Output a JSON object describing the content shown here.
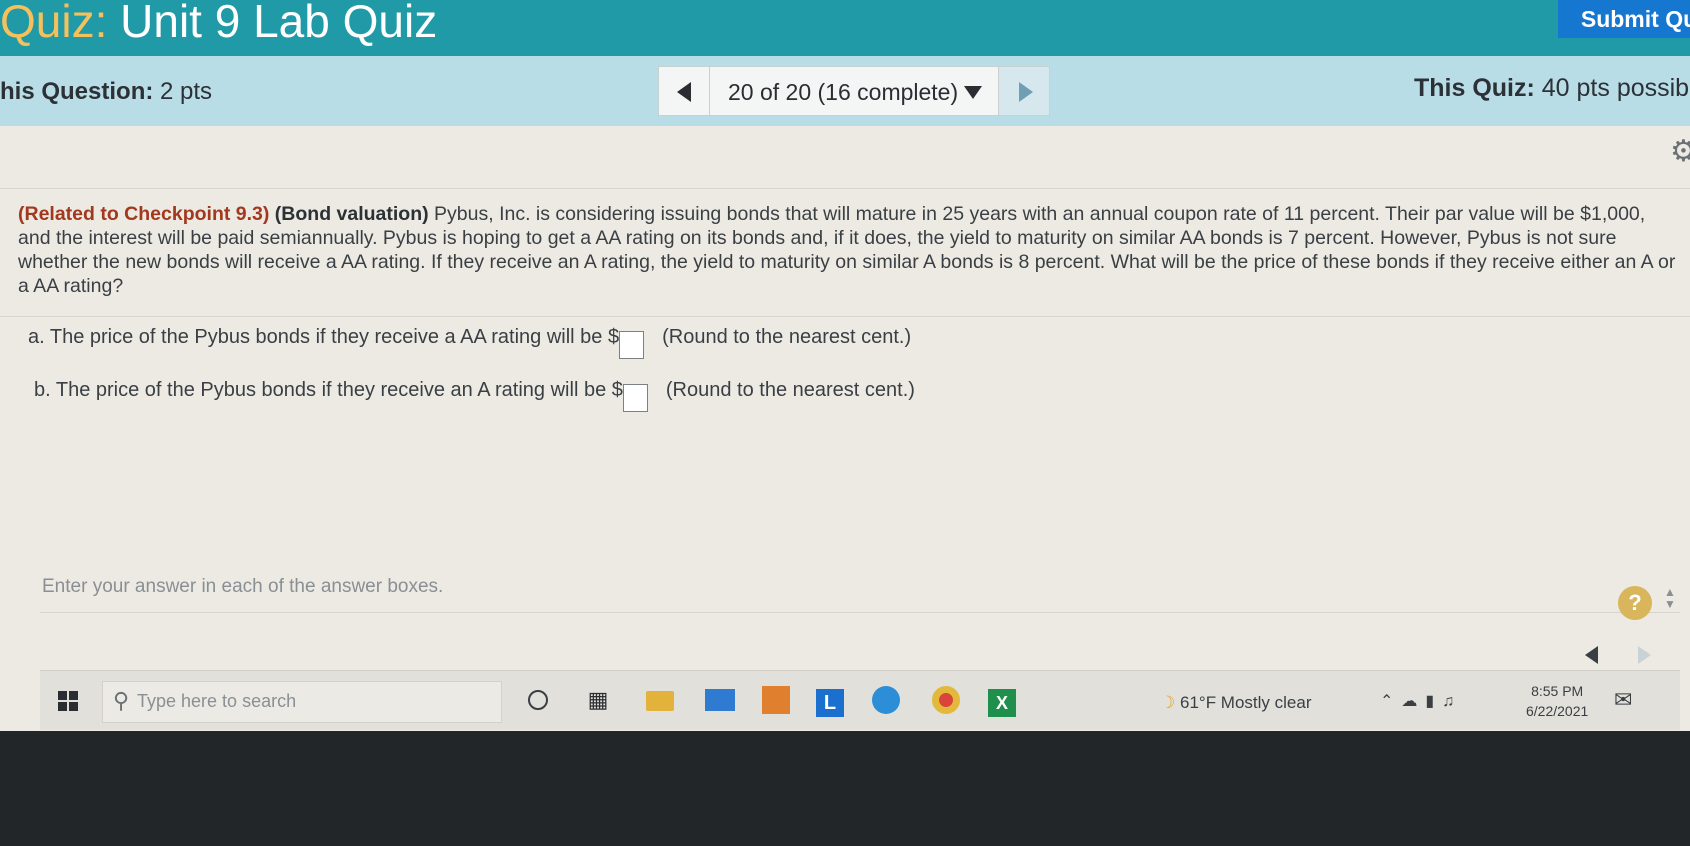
{
  "header": {
    "title_prefix": "Quiz:",
    "title_rest": " Unit 9 Lab Quiz",
    "submit_label": "Submit Qu"
  },
  "infobar": {
    "question_label": "his Question:",
    "question_pts": " 2 pts",
    "progress": "20 of 20 (16 complete)",
    "quiz_label": "This Quiz:",
    "quiz_pts": " 40 pts possib"
  },
  "question": {
    "ref": "(Related to Checkpoint 9.3)",
    "topic": "(Bond valuation)",
    "body": " Pybus, Inc. is considering issuing bonds that will mature in 25 years with an annual coupon rate of 11 percent. Their par value will be $1,000, and the interest will be paid semiannually. Pybus is hoping to get a AA rating on its bonds and, if it does, the yield to maturity on similar AA bonds is 7 percent. However, Pybus is not sure whether the new bonds will receive a AA rating. If they receive an A rating, the yield to maturity on similar A bonds is 8 percent. What will be the price of these bonds if they receive either an A or a AA rating?"
  },
  "parts": [
    {
      "text": "a. The price of the Pybus bonds if they receive a AA rating will be $",
      "value": "",
      "note": "(Round to the nearest cent.)"
    },
    {
      "text": "b. The price of the Pybus bonds if they receive an A rating will be $",
      "value": "",
      "note": "(Round to the nearest cent.)"
    }
  ],
  "instruction": "Enter your answer in each of the answer boxes.",
  "help_label": "?",
  "taskbar": {
    "search_placeholder": "Type here to search",
    "weather": "61°F Mostly clear",
    "time": "8:55 PM",
    "date": "6/22/2021",
    "l_app_label": "L",
    "excel_label": "X"
  },
  "colors": {
    "header_bg": "#1f9aa6",
    "title_prefix": "#f6c15c",
    "submit_bg": "#1677d1",
    "infobar_bg": "#b9dde6",
    "question_ref": "#a2391f",
    "help_bg": "#d9b55c"
  }
}
